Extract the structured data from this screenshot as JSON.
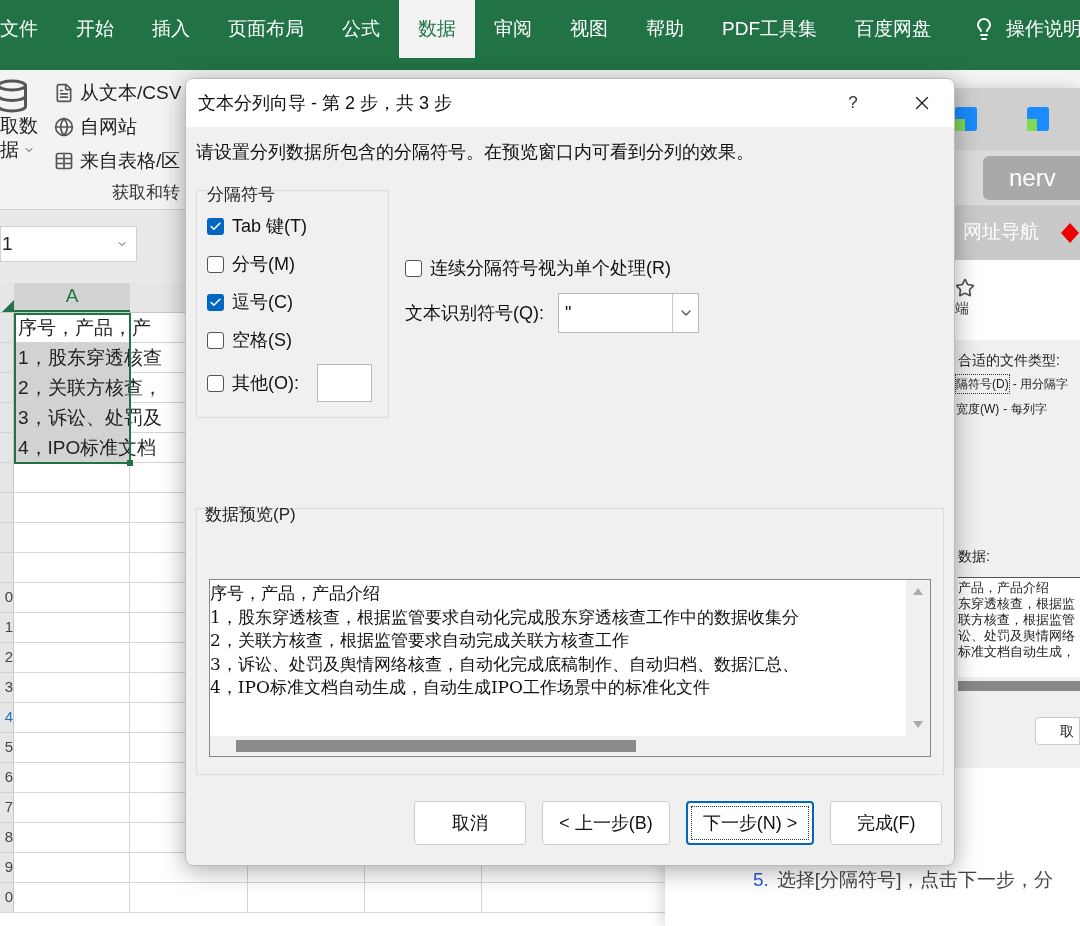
{
  "ribbon_tabs": [
    {
      "label": "文件",
      "selected": false
    },
    {
      "label": "开始",
      "selected": false
    },
    {
      "label": "插入",
      "selected": false
    },
    {
      "label": "页面布局",
      "selected": false
    },
    {
      "label": "公式",
      "selected": false
    },
    {
      "label": "数据",
      "selected": true
    },
    {
      "label": "审阅",
      "selected": false
    },
    {
      "label": "视图",
      "selected": false
    },
    {
      "label": "帮助",
      "selected": false
    },
    {
      "label": "PDF工具集",
      "selected": false
    },
    {
      "label": "百度网盘",
      "selected": false
    }
  ],
  "tell_me": "操作说明",
  "ribbon": {
    "get_data_label": [
      "取数",
      "据"
    ],
    "commands": [
      "从文本/CSV",
      "自网站",
      "来自表格/区"
    ],
    "group_label": "获取和转"
  },
  "name_box": "1",
  "sheet": {
    "column_header": "A",
    "cells": [
      "序号，产品，产",
      "1，股东穿透核查",
      "2，关联方核查，",
      "3，诉讼、处罚及",
      "4，IPO标准文档"
    ],
    "row_numbers": [
      {
        "label": "0",
        "highlighted": false
      },
      {
        "label": "1",
        "highlighted": false
      },
      {
        "label": "2",
        "highlighted": false
      },
      {
        "label": "3",
        "highlighted": false
      },
      {
        "label": "4",
        "highlighted": true
      },
      {
        "label": "5",
        "highlighted": false
      },
      {
        "label": "6",
        "highlighted": false
      },
      {
        "label": "7",
        "highlighted": false
      },
      {
        "label": "8",
        "highlighted": false
      },
      {
        "label": "9",
        "highlighted": false
      },
      {
        "label": "0",
        "highlighted": false
      }
    ]
  },
  "browser": {
    "address": "nerv",
    "nav_link": "网址导航",
    "page_text": "端",
    "embedded_wizard": {
      "prompt": "合适的文件类型:",
      "options": [
        {
          "label": "隔符号(D)",
          "description": "- 用分隔字",
          "selected": true
        },
        {
          "label": "宽度(W)",
          "description": "- 每列字",
          "selected": false
        }
      ],
      "preview_label": "数据:",
      "preview_lines": [
        "产品，产品介绍",
        "东穿透核查，根据监",
        "联方核查，根据监管",
        "讼、处罚及舆情网络",
        "标准文档自动生成，"
      ],
      "cancel": "取"
    },
    "caption": {
      "number": "5.",
      "text": "选择[分隔符号]，点击下一步，分"
    }
  },
  "dialog": {
    "title": "文本分列向导 - 第 2 步，共 3 步",
    "help": "?",
    "instruction": "请设置分列数据所包含的分隔符号。在预览窗口内可看到分列的效果。",
    "delimiters_legend": "分隔符号",
    "delimiters": [
      {
        "label": "Tab 键(T)",
        "checked": true,
        "kind": "checkbox"
      },
      {
        "label": "分号(M)",
        "checked": false,
        "kind": "checkbox"
      },
      {
        "label": "逗号(C)",
        "checked": true,
        "kind": "checkbox"
      },
      {
        "label": "空格(S)",
        "checked": false,
        "kind": "checkbox"
      },
      {
        "label": "其他(O):",
        "checked": false,
        "kind": "with_field"
      }
    ],
    "consecutive": {
      "label": "连续分隔符号视为单个处理(R)",
      "checked": false
    },
    "qualifier": {
      "label": "文本识别符号(Q):",
      "value": "\""
    },
    "preview_legend": "数据预览(P)",
    "preview_lines": [
      "序号，产品，产品介绍",
      "1，股东穿透核查，根据监管要求自动化完成股东穿透核查工作中的数据收集分",
      "2，关联方核查，根据监管要求自动完成关联方核查工作",
      "3，诉讼、处罚及舆情网络核查，自动化完成底稿制作、自动归档、数据汇总、",
      "4，IPO标准文档自动生成，自动生成IPO工作场景中的标准化文件"
    ],
    "buttons": [
      {
        "label": "取消",
        "focused": false
      },
      {
        "label": "< 上一步(B)",
        "focused": false
      },
      {
        "label": "下一步(N) >",
        "focused": true
      },
      {
        "label": "完成(F)",
        "focused": false
      }
    ]
  }
}
